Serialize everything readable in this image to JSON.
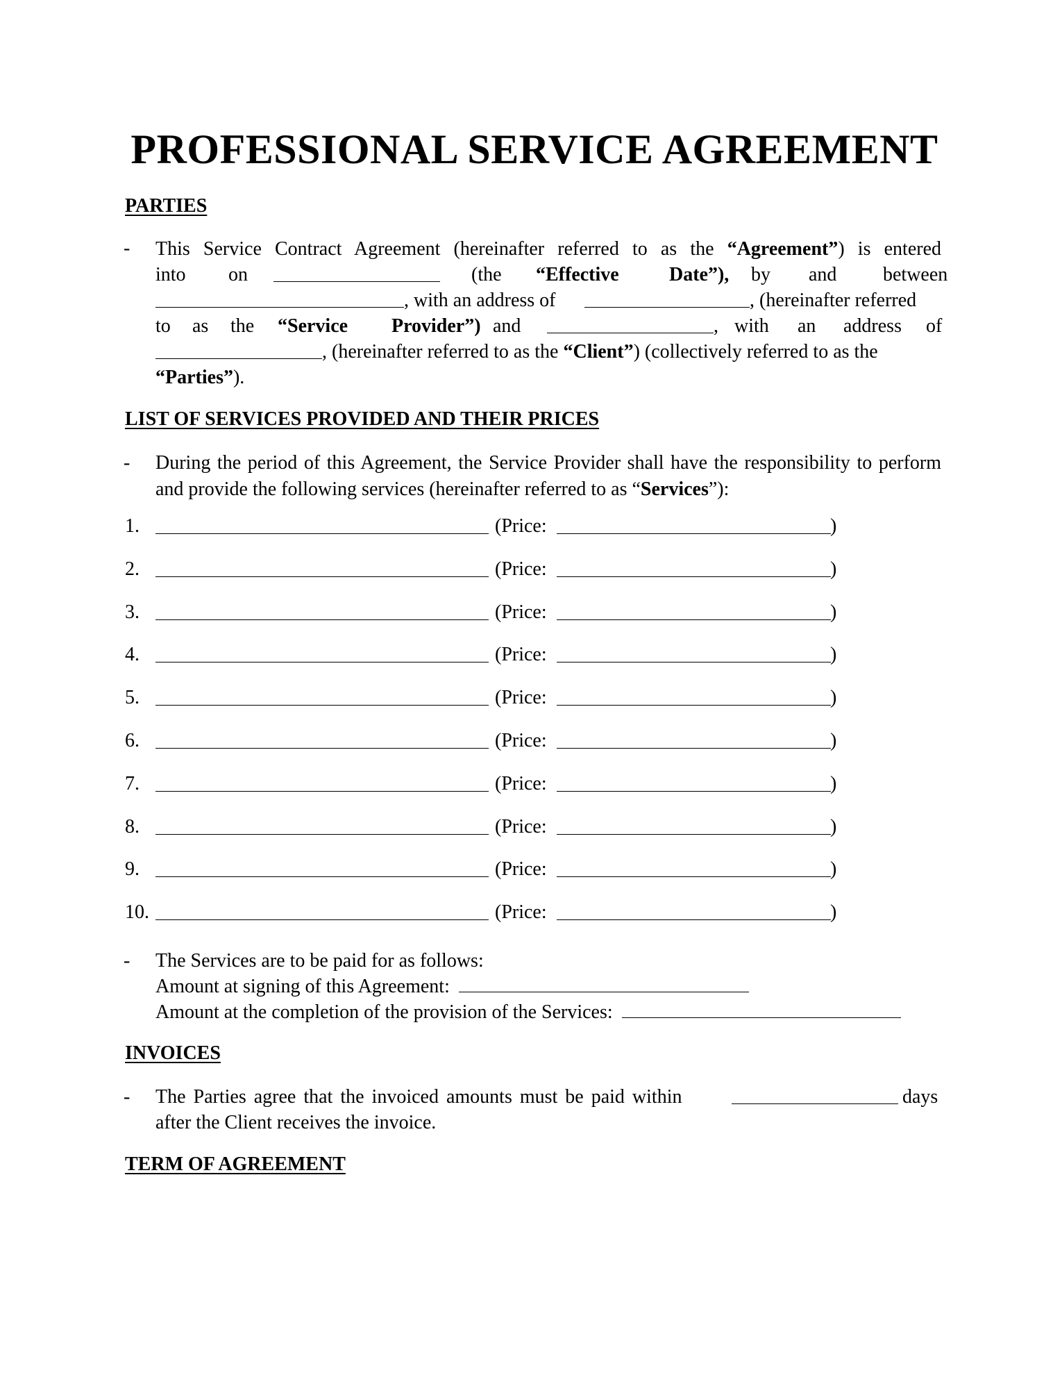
{
  "document": {
    "title": "PROFESSIONAL SERVICE AGREEMENT",
    "sections": {
      "parties": {
        "heading": "PARTIES",
        "bullet": "-",
        "text": {
          "p1": "This Service Contract Agreement (hereinafter referred to as the ",
          "agreement_term": "“Agreement”",
          "p2": ") is entered into on ",
          "p3": " (the ",
          "effective_date_term": "“Effective Date”",
          "p4": "), by and between ",
          "p5": ", with an address of ",
          "p6": ", (hereinafter referred to as the ",
          "provider_term": "“Service Provider”",
          "p7": ") and ",
          "p8": ", with an address of ",
          "p9": ", (hereinafter referred to as the ",
          "client_term": "“Client”",
          "p10": ") (collectively referred to as the ",
          "parties_term": "“Parties”",
          "p11": ")."
        },
        "fields": {
          "effective_date": "",
          "provider_name": "",
          "provider_address": "",
          "client_name": "",
          "client_address": ""
        }
      },
      "services": {
        "heading": "LIST OF SERVICES PROVIDED AND THEIR PRICES",
        "bullet": "-",
        "intro_1": "During the period of this Agreement, the Service Provider shall have the responsibility to perform and provide the following services (hereinafter referred to as “",
        "services_term": "Services",
        "intro_2": "”):",
        "price_label": "(Price:",
        "close_paren": ")",
        "items": [
          {
            "number": "1.",
            "service": "",
            "price": ""
          },
          {
            "number": "2.",
            "service": "",
            "price": ""
          },
          {
            "number": "3.",
            "service": "",
            "price": ""
          },
          {
            "number": "4.",
            "service": "",
            "price": ""
          },
          {
            "number": "5.",
            "service": "",
            "price": ""
          },
          {
            "number": "6.",
            "service": "",
            "price": ""
          },
          {
            "number": "7.",
            "service": "",
            "price": ""
          },
          {
            "number": "8.",
            "service": "",
            "price": ""
          },
          {
            "number": "9.",
            "service": "",
            "price": ""
          },
          {
            "number": "10.",
            "service": "",
            "price": ""
          }
        ],
        "payment": {
          "bullet": "-",
          "intro": "The Services are to be paid for as follows:",
          "signing_label": "Amount at signing of this Agreement:",
          "signing_value": "",
          "completion_label": "Amount at the completion of the provision of the Services:",
          "completion_value": ""
        }
      },
      "invoices": {
        "heading": "INVOICES",
        "bullet": "-",
        "text_1": "The Parties agree that the invoiced amounts must be paid within",
        "days_value": "",
        "text_2": "days",
        "text_3": "after the Client receives the invoice."
      },
      "term": {
        "heading": "TERM OF AGREEMENT"
      }
    }
  }
}
